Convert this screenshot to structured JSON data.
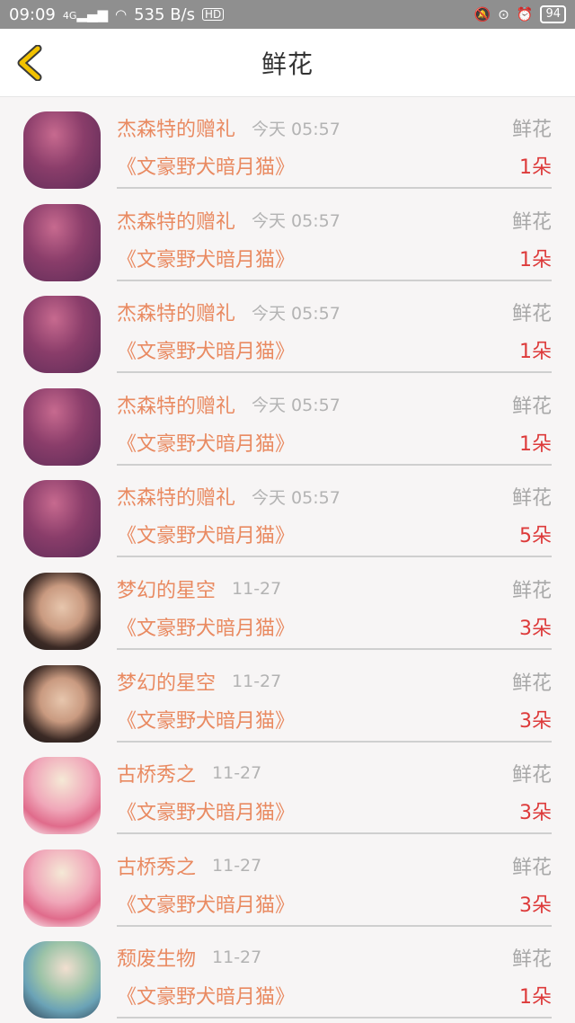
{
  "status": {
    "time": "09:09",
    "signal": "4G",
    "net_speed": "535 B/s",
    "hd": "HD",
    "battery": "94"
  },
  "header": {
    "title": "鲜花",
    "back_icon": "chevron-left-icon"
  },
  "items": [
    {
      "user": "杰森特的赠礼",
      "time": "今天 05:57",
      "type": "鲜花",
      "book": "《文豪野犬暗月猫》",
      "count": "1朵",
      "avatar": "sunset"
    },
    {
      "user": "杰森特的赠礼",
      "time": "今天 05:57",
      "type": "鲜花",
      "book": "《文豪野犬暗月猫》",
      "count": "1朵",
      "avatar": "sunset"
    },
    {
      "user": "杰森特的赠礼",
      "time": "今天 05:57",
      "type": "鲜花",
      "book": "《文豪野犬暗月猫》",
      "count": "1朵",
      "avatar": "sunset"
    },
    {
      "user": "杰森特的赠礼",
      "time": "今天 05:57",
      "type": "鲜花",
      "book": "《文豪野犬暗月猫》",
      "count": "1朵",
      "avatar": "sunset"
    },
    {
      "user": "杰森特的赠礼",
      "time": "今天 05:57",
      "type": "鲜花",
      "book": "《文豪野犬暗月猫》",
      "count": "5朵",
      "avatar": "sunset"
    },
    {
      "user": "梦幻的星空",
      "time": "11-27",
      "type": "鲜花",
      "book": "《文豪野犬暗月猫》",
      "count": "3朵",
      "avatar": "boy"
    },
    {
      "user": "梦幻的星空",
      "time": "11-27",
      "type": "鲜花",
      "book": "《文豪野犬暗月猫》",
      "count": "3朵",
      "avatar": "boy"
    },
    {
      "user": "古桥秀之",
      "time": "11-27",
      "type": "鲜花",
      "book": "《文豪野犬暗月猫》",
      "count": "3朵",
      "avatar": "anime"
    },
    {
      "user": "古桥秀之",
      "time": "11-27",
      "type": "鲜花",
      "book": "《文豪野犬暗月猫》",
      "count": "3朵",
      "avatar": "anime"
    },
    {
      "user": "颓废生物",
      "time": "11-27",
      "type": "鲜花",
      "book": "《文豪野犬暗月猫》",
      "count": "1朵",
      "avatar": "girl"
    }
  ],
  "colors": {
    "accent_orange": "#e98a61",
    "count_red": "#dd3a3a",
    "back_yellow": "#f2c200"
  }
}
